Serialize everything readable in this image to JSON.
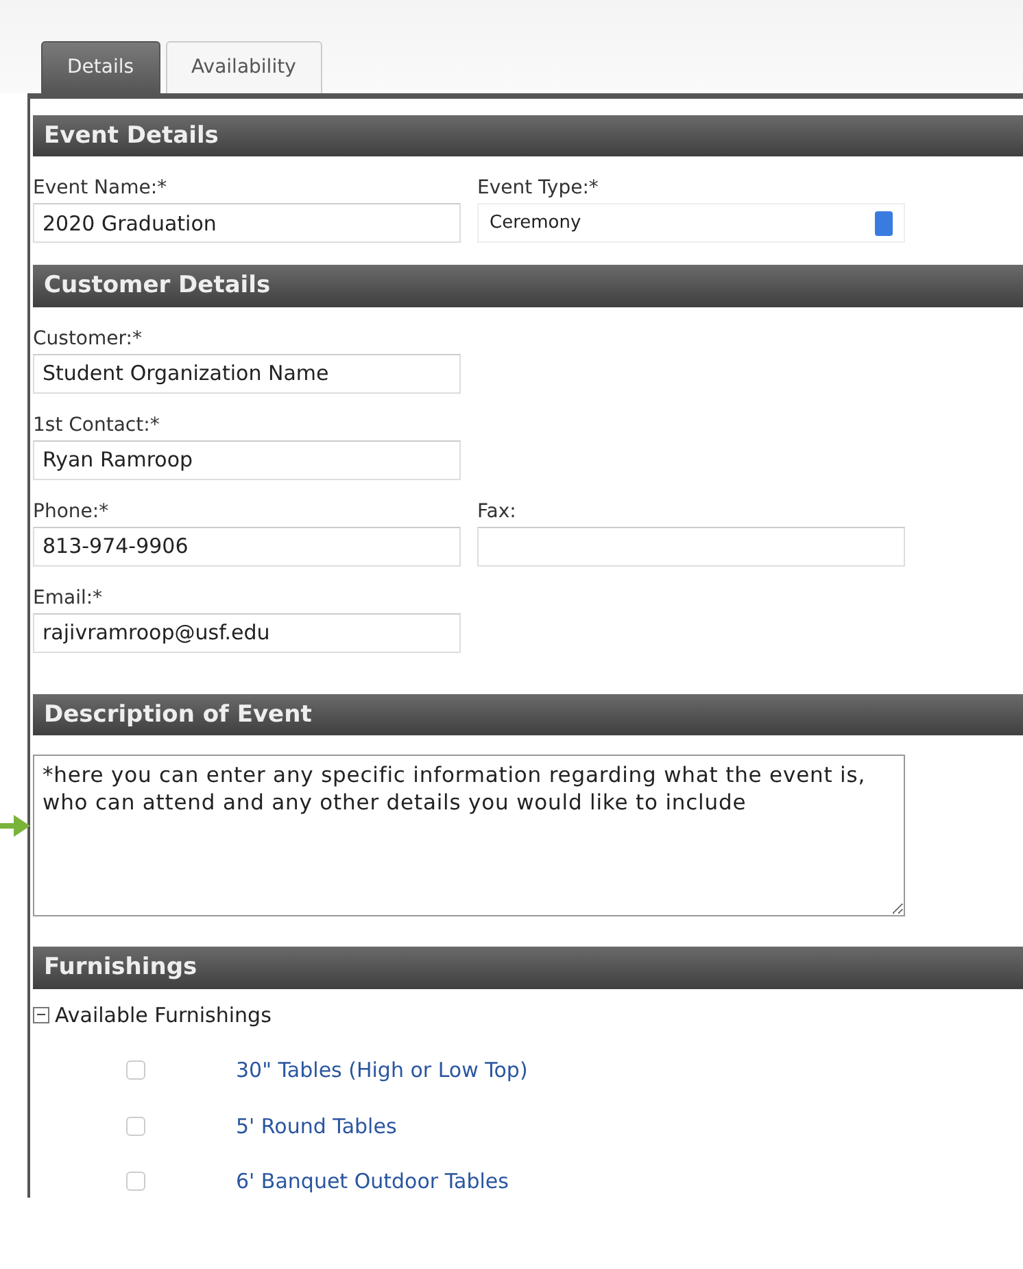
{
  "tabs": [
    {
      "label": "Details",
      "selected": true
    },
    {
      "label": "Availability",
      "selected": false
    }
  ],
  "sections": [
    {
      "title": "Event Details",
      "rows": [
        [
          {
            "label": "Event Name:*",
            "kind": "text",
            "value": "2020 Graduation"
          },
          {
            "label": "Event Type:*",
            "kind": "select",
            "value": "Ceremony"
          }
        ]
      ]
    },
    {
      "title": "Customer Details",
      "rows": [
        [
          {
            "label": "Customer:*",
            "kind": "text",
            "value": "Student Organization Name"
          }
        ],
        [
          {
            "label": "1st Contact:*",
            "kind": "text",
            "value": "Ryan Ramroop"
          }
        ],
        [
          {
            "label": "Phone:*",
            "kind": "text",
            "value": "813-974-9906"
          },
          {
            "label": "Fax:",
            "kind": "text"
          }
        ],
        [
          {
            "label": "Email:*",
            "kind": "text",
            "value": "rajivramroop@usf.edu"
          }
        ]
      ]
    },
    {
      "title": "Description of Event",
      "description": "*here you can enter any specific information regarding what the event is, who can attend and any other details you would like to include"
    },
    {
      "title": "Furnishings",
      "group": {
        "label": "Available Furnishings",
        "expanded": true,
        "items": [
          {
            "label": "30\" Tables (High or Low Top)",
            "checked": false
          },
          {
            "label": "5' Round Tables",
            "checked": false
          },
          {
            "label": "6' Banquet Outdoor Tables",
            "checked": false
          }
        ]
      }
    }
  ]
}
